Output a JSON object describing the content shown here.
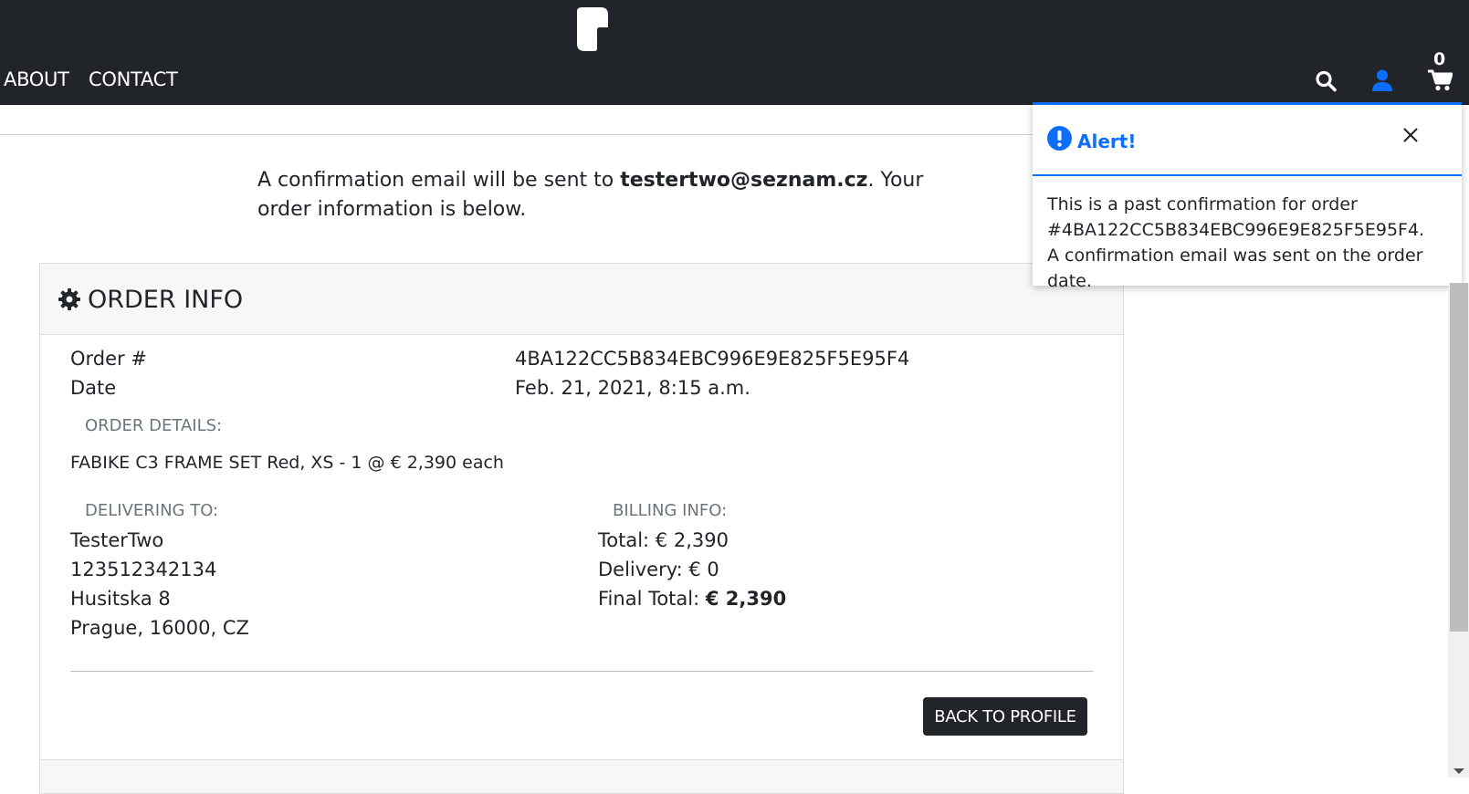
{
  "nav": {
    "links": [
      "ABOUT",
      "CONTACT"
    ],
    "cart_count": "0",
    "icons": [
      "search-icon",
      "user-icon",
      "cart-icon"
    ],
    "accent_color": "#0d6efd"
  },
  "intro": {
    "prefix": "A confirmation email will be sent to ",
    "email": "testertwo@seznam.cz",
    "suffix": ". Your order information is below."
  },
  "order": {
    "title": "ORDER INFO",
    "number_label": "Order #",
    "number_value": "4BA122CC5B834EBC996E9E825F5E95F4",
    "date_label": "Date",
    "date_value": "Feb. 21, 2021, 8:15 a.m.",
    "details_label": "ORDER DETAILS:",
    "item_line": "FABIKE C3 FRAME SET Red, XS - 1 @ € 2,390 each",
    "delivering_label": "DELIVERING TO:",
    "delivering": [
      "TesterTwo",
      "123512342134",
      "Husitska 8",
      "Prague, 16000, CZ"
    ],
    "billing_label": "BILLING INFO:",
    "total": "Total: € 2,390",
    "delivery": "Delivery: € 0",
    "final_total_label": "Final Total: ",
    "final_total_value": "€ 2,390",
    "back_button": "BACK TO PROFILE"
  },
  "alert": {
    "title": "Alert!",
    "message": "This is a past confirmation for order #4BA122CC5B834EBC996E9E825F5E95F4. A confirmation email was sent on the order date."
  }
}
